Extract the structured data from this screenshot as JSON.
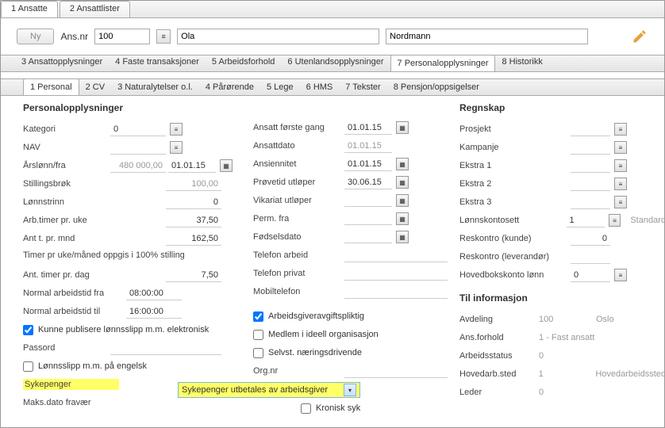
{
  "main_tabs": {
    "t1": "1 Ansatte",
    "t2": "2 Ansattlister"
  },
  "toolbar": {
    "ny": "Ny",
    "ansnr_label": "Ans.nr",
    "ansnr_value": "100",
    "fname": "Ola",
    "lname": "Nordmann"
  },
  "subtabs": {
    "t3": "3 Ansattopplysninger",
    "t4": "4 Faste transaksjoner",
    "t5": "5 Arbeidsforhold",
    "t6": "6 Utenlandsopplysninger",
    "t7": "7 Personalopplysninger",
    "t8": "8 Historikk"
  },
  "subtabs2": {
    "p1": "1 Personal",
    "p2": "2 CV",
    "p3": "3 Naturalytelser o.l.",
    "p4": "4 Pårørende",
    "p5": "5 Lege",
    "p6": "6 HMS",
    "p7": "7 Tekster",
    "p8": "8 Pensjon/oppsigelser"
  },
  "sections": {
    "personal": "Personalopplysninger",
    "regnskap": "Regnskap",
    "tilinfo": "Til informasjon"
  },
  "col1": {
    "kategori_l": "Kategori",
    "kategori_v": "0",
    "nav_l": "NAV",
    "arslonn_l": "Årslønn/fra",
    "arslonn_v": "480 000,00",
    "arslonn_d": "01.01.15",
    "stillingsbrok_l": "Stillingsbrøk",
    "stillingsbrok_v": "100,00",
    "lonnstrinn_l": "Lønnstrinn",
    "lonnstrinn_v": "0",
    "arbtimer_l": "Arb.timer pr. uke",
    "arbtimer_v": "37,50",
    "antt_l": "Ant t. pr. mnd",
    "antt_v": "162,50",
    "note": "Timer pr uke/måned oppgis i 100% stilling",
    "anttimerdag_l": "Ant. timer pr. dag",
    "anttimerdag_v": "7,50",
    "arbfra_l": "Normal arbeidstid fra",
    "arbfra_v": "08:00:00",
    "arbtil_l": "Normal arbeidstid til",
    "arbtil_v": "16:00:00",
    "kunnepub": "Kunne publisere lønnsslipp m.m. elektronisk",
    "passord_l": "Passord",
    "engelsk": "Lønnsslipp m.m. på engelsk",
    "sykepenger_l": "Sykepenger",
    "sykepenger_v": "Sykepenger utbetales av arbeidsgiver",
    "maksdato_l": "Maks.dato fravær"
  },
  "col2": {
    "ansatt1_l": "Ansatt første gang",
    "ansatt1_v": "01.01.15",
    "ansattdato_l": "Ansattdato",
    "ansattdato_v": "01.01.15",
    "ansien_l": "Ansiennitet",
    "ansien_v": "01.01.15",
    "provetid_l": "Prøvetid utløper",
    "provetid_v": "30.06.15",
    "vikariat_l": "Vikariat utløper",
    "permfra_l": "Perm. fra",
    "fodsel_l": "Fødselsdato",
    "tlfarb_l": "Telefon arbeid",
    "tlfpriv_l": "Telefon privat",
    "mobil_l": "Mobiltelefon",
    "avgift": "Arbeidsgiveravgiftspliktig",
    "ideell": "Medlem i ideell organisasjon",
    "selvst": "Selvst. næringsdrivende",
    "orgnr_l": "Org.nr",
    "kronisk": "Kronisk syk"
  },
  "col3": {
    "prosjekt_l": "Prosjekt",
    "kampanje_l": "Kampanje",
    "ekstra1_l": "Ekstra 1",
    "ekstra2_l": "Ekstra 2",
    "ekstra3_l": "Ekstra 3",
    "lonnskonto_l": "Lønnskontosett",
    "lonnskonto_v": "1",
    "lonnskonto_s": "Standard",
    "reskunde_l": "Reskontro (kunde)",
    "reskunde_v": "0",
    "reslever_l": "Reskontro (leverandør)",
    "hovedbok_l": "Hovedbokskonto lønn",
    "hovedbok_v": "0",
    "avdeling_l": "Avdeling",
    "avdeling_v": "100",
    "avdeling_s": "Oslo",
    "ansforhold_l": "Ans.forhold",
    "ansforhold_v": "1 - Fast ansatt",
    "arbstatus_l": "Arbeidsstatus",
    "arbstatus_v": "0",
    "hovedarb_l": "Hovedarb.sted",
    "hovedarb_v": "1",
    "hovedarb_s": "Hovedarbeidssted",
    "leder_l": "Leder",
    "leder_v": "0"
  }
}
